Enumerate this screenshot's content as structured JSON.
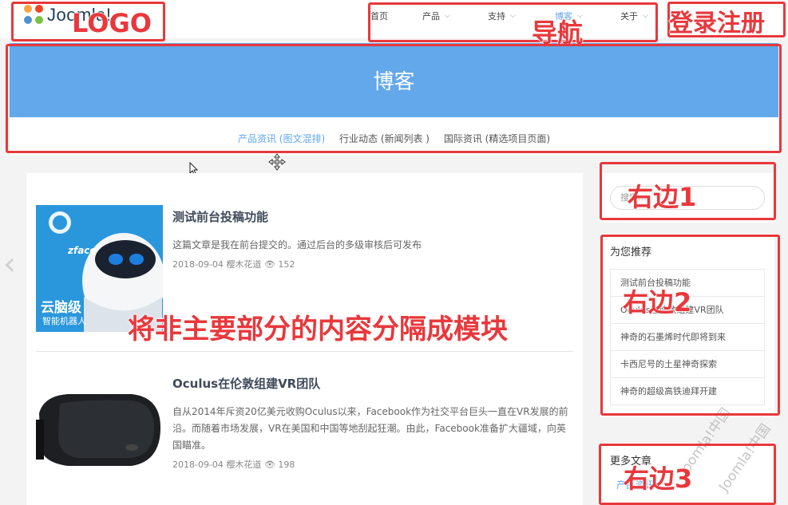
{
  "header": {
    "logo_text": "Joomla!",
    "nav": [
      {
        "label": "首页",
        "has_dropdown": false
      },
      {
        "label": "产品",
        "has_dropdown": true
      },
      {
        "label": "支持",
        "has_dropdown": true
      },
      {
        "label": "博客",
        "has_dropdown": true
      },
      {
        "label": "关于",
        "has_dropdown": true
      }
    ]
  },
  "banner": {
    "title": "博客",
    "subnav": [
      {
        "label": "产品资讯 (图文混排)",
        "active": true
      },
      {
        "label": "行业动态 (新闻列表 )",
        "active": false
      },
      {
        "label": "国际资讯 (精选项目页面)",
        "active": false
      }
    ]
  },
  "articles": [
    {
      "title": "测试前台投稿功能",
      "summary": "这篇文章是我在前台提交的。通过后台的多级审核后可发布",
      "date": "2018-09-04",
      "author": "樱木花道",
      "views": "152",
      "thumb_text_top": "云脑级",
      "thumb_text_bottom": "智能机器人",
      "thumb_brand": "zface"
    },
    {
      "title": "Oculus在伦敦组建VR团队",
      "summary": "自从2014年斥资20亿美元收购Oculus以来，Facebook作为社交平台巨头一直在VR发展的前沿。而随着市场发展，VR在美国和中国等地刮起狂潮。由此，Facebook准备扩大疆域，向英国瞄准。",
      "date": "2018-09-04",
      "author": "樱木花道",
      "views": "198"
    }
  ],
  "sidebar": {
    "search_placeholder": "搜索...",
    "recommend_heading": "为您推荐",
    "recommend_items": [
      "测试前台投稿功能",
      "Oculus在伦敦组建VR团队",
      "神奇的石墨烯时代即将到来",
      "卡西尼号的土星神奇探索",
      "神奇的超级高铁迪拜开建"
    ],
    "more_heading": "更多文章",
    "more_link": "产品资讯"
  },
  "annotations": {
    "logo": "LOGO",
    "nav": "导航",
    "login": "登录注册",
    "right1": "右边1",
    "right2": "右边2",
    "right3": "右边3",
    "module_note": "将非主要部分的内容分隔成模块"
  },
  "watermarks": [
    "Joomla!中国",
    "Joomla!中国"
  ],
  "colors": {
    "accent": "#62a8ea",
    "annotation_red": "#e8383c",
    "page_bg": "#f3f3f3"
  }
}
